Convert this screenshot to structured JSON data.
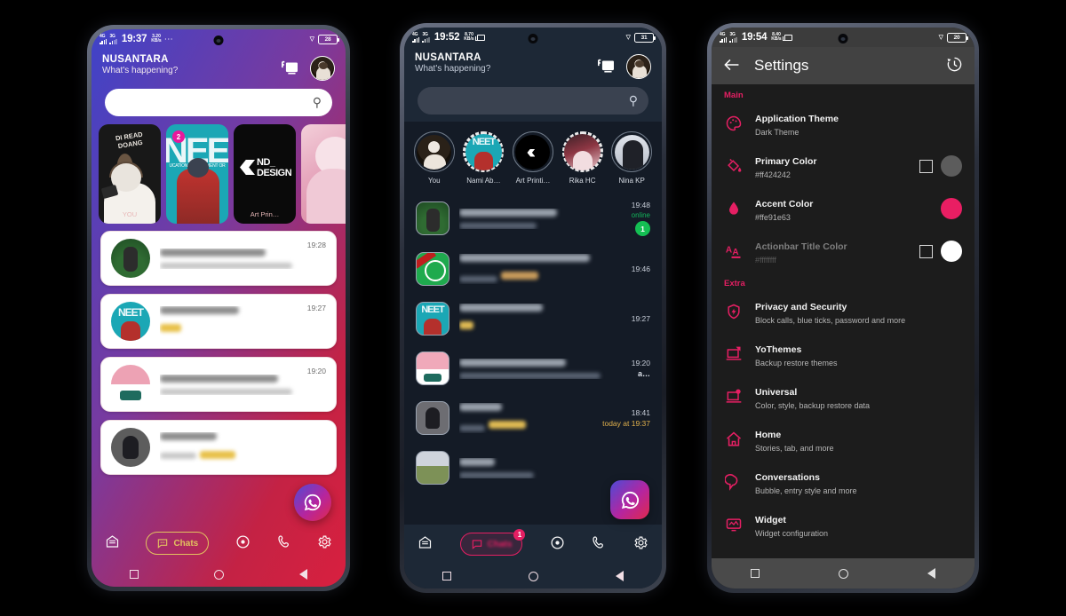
{
  "phone1": {
    "status": {
      "net1": "4G",
      "net2": "3G",
      "time": "19:37",
      "speed_num": "3.20",
      "speed_unit": "KB/s",
      "dots": "⋯",
      "wifi": "wifi-icon",
      "battery": "28"
    },
    "header": {
      "title": "NUSANTARA",
      "subtitle": "What's happening?",
      "cast_icon": "cast-icon",
      "avatar": "avatar"
    },
    "search": {
      "placeholder": "",
      "icon": "search-icon"
    },
    "stories": [
      {
        "caption": "YOU",
        "title": "DI READ DOANG",
        "badge": ""
      },
      {
        "caption": "",
        "title": "NEET",
        "subtitle": "UCATION EMPLOYMENT OR",
        "badge": "2"
      },
      {
        "caption": "Art Prin…",
        "title": "ND_DESIGN",
        "badge": ""
      },
      {
        "caption": "",
        "title": "",
        "badge": ""
      }
    ],
    "chats": [
      {
        "time": "19:28",
        "avatar": "photo-avatar"
      },
      {
        "time": "19:27",
        "avatar": "neet-avatar"
      },
      {
        "time": "19:20",
        "avatar": "flag-avatar",
        "trailing": "…"
      },
      {
        "time": "",
        "avatar": "bat-avatar"
      }
    ],
    "fab": {
      "icon": "whatsapp-icon"
    },
    "nav": [
      {
        "icon": "home-icon",
        "label": ""
      },
      {
        "icon": "chats-icon",
        "label": "Chats"
      },
      {
        "icon": "status-icon",
        "label": ""
      },
      {
        "icon": "calls-icon",
        "label": ""
      },
      {
        "icon": "settings-icon",
        "label": ""
      }
    ]
  },
  "phone2": {
    "status": {
      "net1": "4G",
      "net2": "3G",
      "time": "19:52",
      "speed_num": "8.70",
      "speed_unit": "KB/s",
      "cast": "cast-icon",
      "wifi": "wifi-icon",
      "battery": "31"
    },
    "header": {
      "title": "NUSANTARA",
      "subtitle": "What's happening?",
      "cast_icon": "cast-icon",
      "avatar": "avatar"
    },
    "search": {
      "placeholder": "",
      "icon": "search-icon"
    },
    "statuses": [
      {
        "name": "You",
        "ring": "seen"
      },
      {
        "name": "Nami Ab…",
        "ring": "unseen"
      },
      {
        "name": "Art Printi…",
        "ring": "seen"
      },
      {
        "name": "Rika HC",
        "ring": "unseen"
      },
      {
        "name": "Nina KP",
        "ring": "seen"
      }
    ],
    "chats": [
      {
        "time": "19:48",
        "online": "online",
        "badge": "1",
        "avatar": "photo-avatar"
      },
      {
        "time": "19:46",
        "avatar": "wa-mod-avatar"
      },
      {
        "time": "19:27",
        "avatar": "neet-avatar"
      },
      {
        "time": "19:20",
        "attach": "a…",
        "avatar": "flag-avatar"
      },
      {
        "time": "18:41",
        "subtime": "today at 19:37",
        "avatar": "bat-avatar"
      },
      {
        "time": "",
        "avatar": "group-avatar"
      }
    ],
    "fab": {
      "icon": "whatsapp-icon"
    },
    "nav": [
      {
        "icon": "home-icon",
        "label": ""
      },
      {
        "icon": "chats-icon",
        "label": "Chats",
        "badge": "1"
      },
      {
        "icon": "status-icon",
        "label": ""
      },
      {
        "icon": "calls-icon",
        "label": ""
      },
      {
        "icon": "settings-icon",
        "label": ""
      }
    ]
  },
  "phone3": {
    "status": {
      "net1": "4G",
      "net2": "3G",
      "time": "19:54",
      "speed_num": "8.40",
      "speed_unit": "KB/s",
      "cast": "cast-icon",
      "wifi": "wifi-icon",
      "battery": "20"
    },
    "actionbar": {
      "back": "back-arrow-icon",
      "title": "Settings",
      "history": "history-icon"
    },
    "sections": [
      {
        "header": "Main",
        "items": [
          {
            "icon": "palette-icon",
            "title": "Application Theme",
            "subtitle": "Dark Theme",
            "dim": false,
            "checkbox": false,
            "swatch": ""
          },
          {
            "icon": "paint-bucket-icon",
            "title": "Primary Color",
            "subtitle": "#ff424242",
            "dim": false,
            "checkbox": true,
            "swatch": "#5c5c5c"
          },
          {
            "icon": "water-drop-icon",
            "title": "Accent Color",
            "subtitle": "#ffe91e63",
            "dim": false,
            "checkbox": false,
            "swatch": "#e91e63"
          },
          {
            "icon": "text-color-icon",
            "title": "Actionbar Title Color",
            "subtitle": "#ffffffff",
            "dim": true,
            "checkbox": true,
            "swatch": "#ffffff"
          }
        ]
      },
      {
        "header": "Extra",
        "items": [
          {
            "icon": "shield-icon",
            "title": "Privacy and Security",
            "subtitle": "Block calls, blue ticks, password and more",
            "dim": false,
            "checkbox": false,
            "swatch": ""
          },
          {
            "icon": "laptop-theme-icon",
            "title": "YoThemes",
            "subtitle": "Backup restore themes",
            "dim": false,
            "checkbox": false,
            "swatch": ""
          },
          {
            "icon": "laptop-gear-icon",
            "title": "Universal",
            "subtitle": "Color, style, backup restore data",
            "dim": false,
            "checkbox": false,
            "swatch": ""
          },
          {
            "icon": "home-icon",
            "title": "Home",
            "subtitle": "Stories, tab, and more",
            "dim": false,
            "checkbox": false,
            "swatch": ""
          },
          {
            "icon": "bubble-icon",
            "title": "Conversations",
            "subtitle": "Bubble, entry style and more",
            "dim": false,
            "checkbox": false,
            "swatch": ""
          },
          {
            "icon": "widget-icon",
            "title": "Widget",
            "subtitle": "Widget configuration",
            "dim": false,
            "checkbox": false,
            "swatch": ""
          }
        ]
      }
    ]
  },
  "colors": {
    "accent": "#e91e63",
    "primary": "#ff424242",
    "white": "#ffffff",
    "grey": "#5c5c5c"
  }
}
